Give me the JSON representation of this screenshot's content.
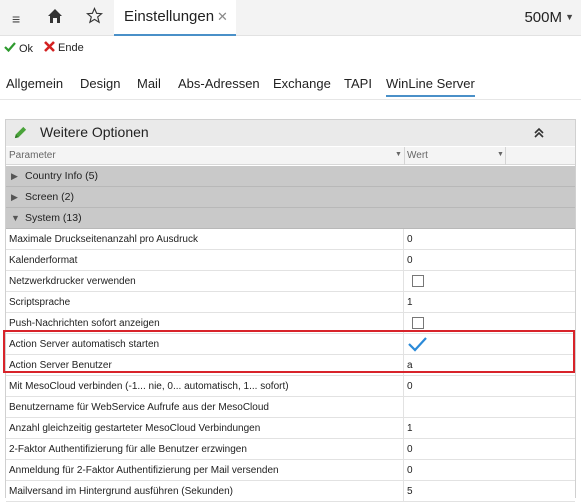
{
  "topbar": {
    "menu_icon": "hamburger-icon",
    "home_icon": "home-icon",
    "star_icon": "star-icon",
    "tab_label": "Einstellungen",
    "tab_close": "✕",
    "right_title": "500M",
    "right_chevron": "▼"
  },
  "toolbar": {
    "ok_label": "Ok",
    "ende_label": "Ende",
    "ok_color": "#2e9a2e",
    "ende_color": "#d32222"
  },
  "subtabs": {
    "allgemein": "Allgemein",
    "design": "Design",
    "mail": "Mail",
    "abs_adressen": "Abs-Adressen",
    "exchange": "Exchange",
    "tapi": "TAPI",
    "winline_server": "WinLine Server",
    "active": "WinLine Server"
  },
  "panel": {
    "title": "Weitere Optionen",
    "col_parameter": "Parameter",
    "col_wert": "Wert"
  },
  "groups": {
    "country": "Country Info (5)",
    "screen": "Screen (2)",
    "system": "System (13)"
  },
  "rows": [
    {
      "name": "Maximale Druckseitenanzahl pro Ausdruck",
      "value": "0"
    },
    {
      "name": "Kalenderformat",
      "value": "0"
    },
    {
      "name": "Netzwerkdrucker verwenden",
      "value": ""
    },
    {
      "name": "Scriptsprache",
      "value": "1"
    },
    {
      "name": "Push-Nachrichten sofort anzeigen",
      "value": ""
    },
    {
      "name": "Action Server automatisch starten",
      "value": ""
    },
    {
      "name": "Action Server Benutzer",
      "value": "a"
    },
    {
      "name": "Mit MesoCloud verbinden (-1... nie, 0... automatisch, 1... sofort)",
      "value": "0"
    },
    {
      "name": "Benutzername für WebService Aufrufe aus der MesoCloud",
      "value": ""
    },
    {
      "name": "Anzahl gleichzeitig gestarteter MesoCloud Verbindungen",
      "value": "1"
    },
    {
      "name": "2-Faktor Authentifizierung für alle Benutzer erzwingen",
      "value": "0"
    },
    {
      "name": "Anmeldung für 2-Faktor Authentifizierung per Mail versenden",
      "value": "0"
    },
    {
      "name": "Mailversand im Hintergrund ausführen (Sekunden)",
      "value": "5"
    }
  ],
  "colors": {
    "accent": "#4a90c8",
    "highlight": "#d8232a",
    "group_bg": "#c9c9c9",
    "check": "#2b8ad8"
  }
}
